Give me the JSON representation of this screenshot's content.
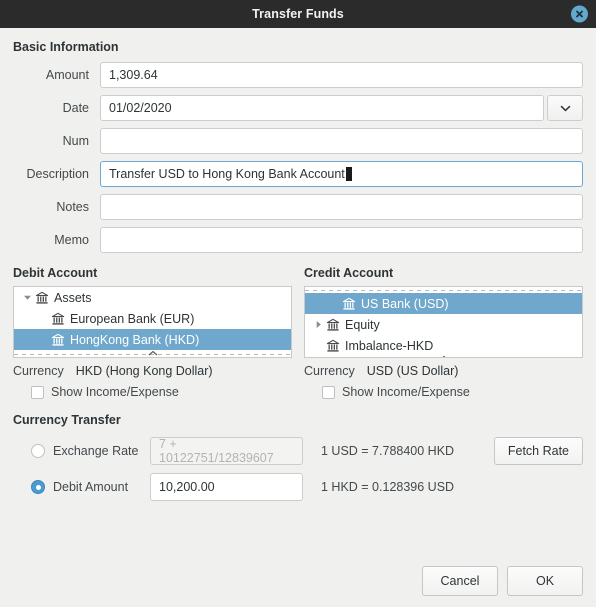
{
  "window": {
    "title": "Transfer Funds",
    "close_icon": "close-icon"
  },
  "basic_information": {
    "heading": "Basic Information",
    "fields": [
      {
        "label": "Amount",
        "value": "1,309.64",
        "placeholder": "",
        "focused": false,
        "has_dropdown": false
      },
      {
        "label": "Date",
        "value": "01/02/2020",
        "placeholder": "",
        "focused": false,
        "has_dropdown": true
      },
      {
        "label": "Num",
        "value": "",
        "placeholder": "",
        "focused": false,
        "has_dropdown": false
      },
      {
        "label": "Description",
        "value": "Transfer USD to Hong Kong Bank Account",
        "placeholder": "",
        "focused": true,
        "has_dropdown": false
      },
      {
        "label": "Notes",
        "value": "",
        "placeholder": "",
        "focused": false,
        "has_dropdown": false
      },
      {
        "label": "Memo",
        "value": "",
        "placeholder": "",
        "focused": false,
        "has_dropdown": false
      }
    ]
  },
  "debit_account": {
    "heading": "Debit Account",
    "rows": [
      {
        "label": "Assets",
        "expander": "expanded",
        "depth": 0,
        "selected": false
      },
      {
        "label": "European Bank (EUR)",
        "expander": "none",
        "depth": 1,
        "selected": false
      },
      {
        "label": "HongKong Bank (HKD)",
        "expander": "none",
        "depth": 1,
        "selected": true
      }
    ],
    "currency_label": "Currency",
    "currency_value": "HKD (Hong Kong Dollar)",
    "show_income_expense_label": "Show Income/Expense",
    "show_income_expense_checked": false
  },
  "credit_account": {
    "heading": "Credit Account",
    "rows": [
      {
        "label": "US Bank (USD)",
        "expander": "none",
        "depth": 1,
        "selected": true
      },
      {
        "label": "Equity",
        "expander": "collapsed",
        "depth": 0,
        "selected": false
      },
      {
        "label": "Imbalance-HKD",
        "expander": "none",
        "depth": 0,
        "selected": false
      }
    ],
    "currency_label": "Currency",
    "currency_value": "USD (US Dollar)",
    "show_income_expense_label": "Show Income/Expense",
    "show_income_expense_checked": false
  },
  "currency_transfer": {
    "heading": "Currency Transfer",
    "exchange_rate": {
      "radio_label": "Exchange Rate",
      "selected": false,
      "input_value": "7 + 10122751/12839607",
      "input_disabled": true,
      "rate_text": "1 USD = 7.788400 HKD",
      "fetch_button": "Fetch Rate"
    },
    "debit_amount": {
      "radio_label": "Debit Amount",
      "selected": true,
      "input_value": "10,200.00",
      "input_disabled": false,
      "rate_text": "1 HKD = 0.128396 USD"
    }
  },
  "footer": {
    "cancel_label": "Cancel",
    "ok_label": "OK"
  },
  "colors": {
    "titlebar_bg": "#2b2b2b",
    "dialog_bg": "#f0f0ef",
    "selection_blue": "#6fa8cc",
    "focus_blue": "#6da8d4",
    "radio_blue": "#4a9bd1",
    "close_blue": "#63a8cd"
  }
}
